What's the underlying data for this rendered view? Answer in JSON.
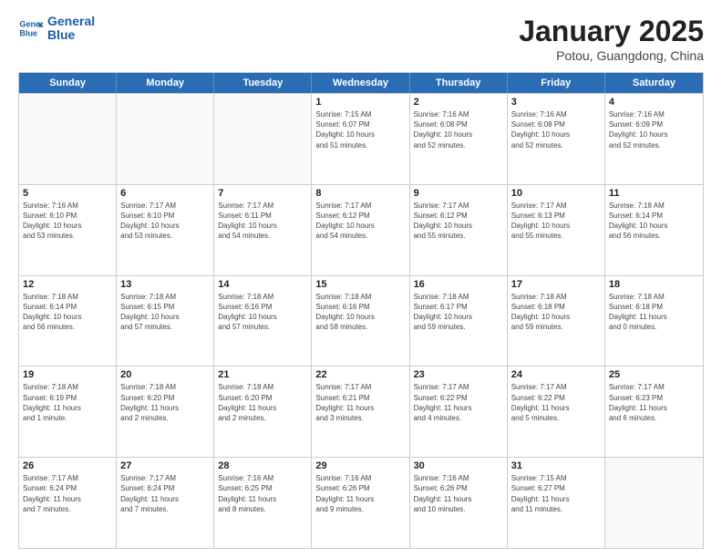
{
  "header": {
    "logo_line1": "General",
    "logo_line2": "Blue",
    "month_title": "January 2025",
    "subtitle": "Potou, Guangdong, China"
  },
  "days_of_week": [
    "Sunday",
    "Monday",
    "Tuesday",
    "Wednesday",
    "Thursday",
    "Friday",
    "Saturday"
  ],
  "weeks": [
    [
      {
        "day": "",
        "info": ""
      },
      {
        "day": "",
        "info": ""
      },
      {
        "day": "",
        "info": ""
      },
      {
        "day": "1",
        "info": "Sunrise: 7:15 AM\nSunset: 6:07 PM\nDaylight: 10 hours\nand 51 minutes."
      },
      {
        "day": "2",
        "info": "Sunrise: 7:16 AM\nSunset: 6:08 PM\nDaylight: 10 hours\nand 52 minutes."
      },
      {
        "day": "3",
        "info": "Sunrise: 7:16 AM\nSunset: 6:08 PM\nDaylight: 10 hours\nand 52 minutes."
      },
      {
        "day": "4",
        "info": "Sunrise: 7:16 AM\nSunset: 6:09 PM\nDaylight: 10 hours\nand 52 minutes."
      }
    ],
    [
      {
        "day": "5",
        "info": "Sunrise: 7:16 AM\nSunset: 6:10 PM\nDaylight: 10 hours\nand 53 minutes."
      },
      {
        "day": "6",
        "info": "Sunrise: 7:17 AM\nSunset: 6:10 PM\nDaylight: 10 hours\nand 53 minutes."
      },
      {
        "day": "7",
        "info": "Sunrise: 7:17 AM\nSunset: 6:11 PM\nDaylight: 10 hours\nand 54 minutes."
      },
      {
        "day": "8",
        "info": "Sunrise: 7:17 AM\nSunset: 6:12 PM\nDaylight: 10 hours\nand 54 minutes."
      },
      {
        "day": "9",
        "info": "Sunrise: 7:17 AM\nSunset: 6:12 PM\nDaylight: 10 hours\nand 55 minutes."
      },
      {
        "day": "10",
        "info": "Sunrise: 7:17 AM\nSunset: 6:13 PM\nDaylight: 10 hours\nand 55 minutes."
      },
      {
        "day": "11",
        "info": "Sunrise: 7:18 AM\nSunset: 6:14 PM\nDaylight: 10 hours\nand 56 minutes."
      }
    ],
    [
      {
        "day": "12",
        "info": "Sunrise: 7:18 AM\nSunset: 6:14 PM\nDaylight: 10 hours\nand 56 minutes."
      },
      {
        "day": "13",
        "info": "Sunrise: 7:18 AM\nSunset: 6:15 PM\nDaylight: 10 hours\nand 57 minutes."
      },
      {
        "day": "14",
        "info": "Sunrise: 7:18 AM\nSunset: 6:16 PM\nDaylight: 10 hours\nand 57 minutes."
      },
      {
        "day": "15",
        "info": "Sunrise: 7:18 AM\nSunset: 6:16 PM\nDaylight: 10 hours\nand 58 minutes."
      },
      {
        "day": "16",
        "info": "Sunrise: 7:18 AM\nSunset: 6:17 PM\nDaylight: 10 hours\nand 59 minutes."
      },
      {
        "day": "17",
        "info": "Sunrise: 7:18 AM\nSunset: 6:18 PM\nDaylight: 10 hours\nand 59 minutes."
      },
      {
        "day": "18",
        "info": "Sunrise: 7:18 AM\nSunset: 6:18 PM\nDaylight: 11 hours\nand 0 minutes."
      }
    ],
    [
      {
        "day": "19",
        "info": "Sunrise: 7:18 AM\nSunset: 6:19 PM\nDaylight: 11 hours\nand 1 minute."
      },
      {
        "day": "20",
        "info": "Sunrise: 7:18 AM\nSunset: 6:20 PM\nDaylight: 11 hours\nand 2 minutes."
      },
      {
        "day": "21",
        "info": "Sunrise: 7:18 AM\nSunset: 6:20 PM\nDaylight: 11 hours\nand 2 minutes."
      },
      {
        "day": "22",
        "info": "Sunrise: 7:17 AM\nSunset: 6:21 PM\nDaylight: 11 hours\nand 3 minutes."
      },
      {
        "day": "23",
        "info": "Sunrise: 7:17 AM\nSunset: 6:22 PM\nDaylight: 11 hours\nand 4 minutes."
      },
      {
        "day": "24",
        "info": "Sunrise: 7:17 AM\nSunset: 6:22 PM\nDaylight: 11 hours\nand 5 minutes."
      },
      {
        "day": "25",
        "info": "Sunrise: 7:17 AM\nSunset: 6:23 PM\nDaylight: 11 hours\nand 6 minutes."
      }
    ],
    [
      {
        "day": "26",
        "info": "Sunrise: 7:17 AM\nSunset: 6:24 PM\nDaylight: 11 hours\nand 7 minutes."
      },
      {
        "day": "27",
        "info": "Sunrise: 7:17 AM\nSunset: 6:24 PM\nDaylight: 11 hours\nand 7 minutes."
      },
      {
        "day": "28",
        "info": "Sunrise: 7:16 AM\nSunset: 6:25 PM\nDaylight: 11 hours\nand 8 minutes."
      },
      {
        "day": "29",
        "info": "Sunrise: 7:16 AM\nSunset: 6:26 PM\nDaylight: 11 hours\nand 9 minutes."
      },
      {
        "day": "30",
        "info": "Sunrise: 7:16 AM\nSunset: 6:26 PM\nDaylight: 11 hours\nand 10 minutes."
      },
      {
        "day": "31",
        "info": "Sunrise: 7:15 AM\nSunset: 6:27 PM\nDaylight: 11 hours\nand 11 minutes."
      },
      {
        "day": "",
        "info": ""
      }
    ]
  ]
}
